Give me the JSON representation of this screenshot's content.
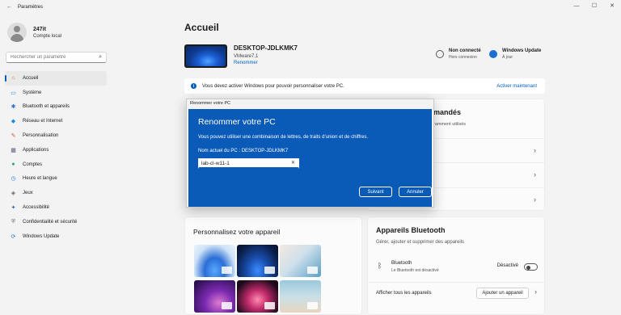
{
  "window": {
    "title": "Paramètres",
    "back": "←",
    "controls": [
      "—",
      "☐",
      "✕"
    ]
  },
  "profile": {
    "name": "247it",
    "subtitle": "Compte local"
  },
  "search": {
    "placeholder": "Rechercher un paramètre"
  },
  "nav": [
    {
      "label": "Accueil",
      "icon": "home-icon",
      "color": "#c46a2a",
      "active": true
    },
    {
      "label": "Système",
      "icon": "system-icon",
      "color": "#1f7fd6"
    },
    {
      "label": "Bluetooth et appareils",
      "icon": "bluetooth-icon",
      "color": "#2a6fd6"
    },
    {
      "label": "Réseau et Internet",
      "icon": "network-icon",
      "color": "#1a8ae0"
    },
    {
      "label": "Personnalisation",
      "icon": "brush-icon",
      "color": "#d05a2a"
    },
    {
      "label": "Applications",
      "icon": "apps-icon",
      "color": "#5a5a8a"
    },
    {
      "label": "Comptes",
      "icon": "accounts-icon",
      "color": "#2aa06a"
    },
    {
      "label": "Heure et langue",
      "icon": "globe-time-icon",
      "color": "#2a7ad6"
    },
    {
      "label": "Jeux",
      "icon": "gamepad-icon",
      "color": "#666666"
    },
    {
      "label": "Accessibilité",
      "icon": "accessibility-icon",
      "color": "#1a6ac0"
    },
    {
      "label": "Confidentialité et sécurité",
      "icon": "shield-icon",
      "color": "#7a7a7a"
    },
    {
      "label": "Windows Update",
      "icon": "update-icon",
      "color": "#1a70d0"
    }
  ],
  "page": {
    "title": "Accueil"
  },
  "device": {
    "name": "DESKTOP-JDLKMK7",
    "model": "VMware7,1",
    "rename": "Renommer"
  },
  "status": {
    "network": {
      "title": "Non connecté",
      "sub": "Hors connexion"
    },
    "update": {
      "title": "Windows Update",
      "sub": "À jour"
    }
  },
  "banner": {
    "text": "Vous devez activer Windows pour pouvoir personnaliser votre PC.",
    "action": "Activer maintenant"
  },
  "recommended": {
    "title": "mandés",
    "subtitle": "ramment utilisés"
  },
  "personalize": {
    "title": "Personnalisez votre appareil"
  },
  "bluetooth": {
    "title": "Appareils Bluetooth",
    "subtitle": "Gérer, ajouter et supprimer des appareils",
    "row_title": "Bluetooth",
    "row_sub": "Le Bluetooth est désactivé",
    "state": "Désactivé",
    "all_devices": "Afficher tous les appareils",
    "add_device": "Ajouter un appareil"
  },
  "dialog": {
    "window_title": "Renommer votre PC",
    "heading": "Renommer votre PC",
    "description": "Vous pouvez utiliser une combinaison de lettres, de traits d’union et de chiffres.",
    "current": "Nom actuel du PC : DESKTOP-JDLKMK7",
    "input_value": "lab-cl-w11-1",
    "next": "Suivant",
    "cancel": "Annuler"
  },
  "colors": {
    "accent": "#005fb8",
    "dialog_bg": "#0a5ab8",
    "window_bg": "#f3f3f3"
  }
}
